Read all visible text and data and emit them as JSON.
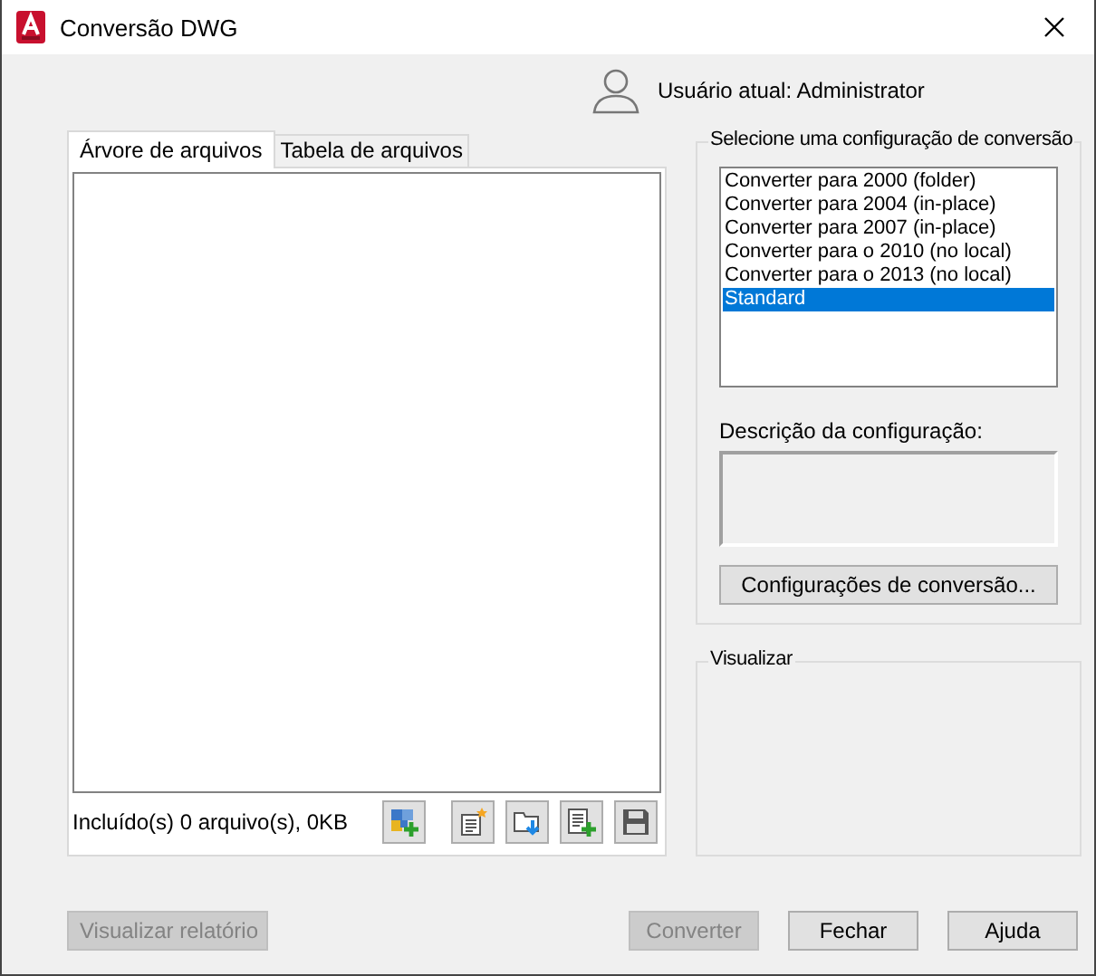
{
  "window": {
    "title": "Conversão DWG"
  },
  "user": {
    "label": "Usuário atual: Administrator"
  },
  "tabs": [
    {
      "label": "Árvore de arquivos",
      "selected": true
    },
    {
      "label": "Tabela de arquivos",
      "selected": false
    }
  ],
  "status": "Incluído(s) 0 arquivo(s), 0KB",
  "configurations": {
    "title": "Selecione uma configuração de conversão",
    "items": [
      {
        "label": "Converter para 2000 (folder)",
        "selected": false
      },
      {
        "label": "Converter para 2004 (in-place)",
        "selected": false
      },
      {
        "label": "Converter para 2007 (in-place)",
        "selected": false
      },
      {
        "label": "Converter para o 2010 (no local)",
        "selected": false
      },
      {
        "label": "Converter para o 2013 (no local)",
        "selected": false
      },
      {
        "label": "Standard",
        "selected": true
      }
    ],
    "description_label": "Descrição da configuração:",
    "settings_button": "Configurações de conversão..."
  },
  "preview": {
    "title": "Visualizar"
  },
  "buttons": [
    {
      "label": "Visualizar relatório",
      "disabled": true,
      "kind": "left"
    },
    {
      "label": "Converter",
      "disabled": true,
      "kind": "right"
    },
    {
      "label": "Fechar",
      "disabled": false,
      "kind": "right"
    },
    {
      "label": "Ajuda",
      "disabled": false,
      "kind": "right"
    }
  ]
}
